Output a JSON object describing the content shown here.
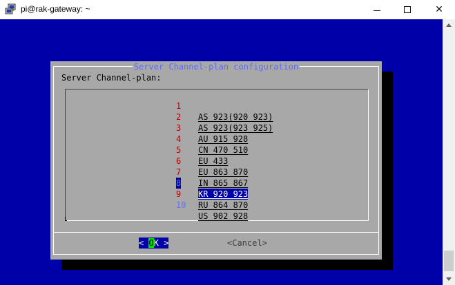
{
  "window": {
    "title": "pi@rak-gateway: ~",
    "icons": {
      "app": "putty-icon",
      "minimize": "minimize-icon",
      "maximize": "maximize-icon",
      "close": "close-icon"
    },
    "close_glyph": "✕"
  },
  "dialog": {
    "title": "Server Channel-plan configuration",
    "prompt": "Server Channel-plan:",
    "items": [
      {
        "num": "1",
        "label": "AS_923(920_923)"
      },
      {
        "num": "2",
        "label": "AS_923(923_925)"
      },
      {
        "num": "3",
        "label": "AU_915_928"
      },
      {
        "num": "4",
        "label": "CN_470_510"
      },
      {
        "num": "5",
        "label": "EU_433"
      },
      {
        "num": "6",
        "label": "EU_863_870"
      },
      {
        "num": "7",
        "label": "IN_865_867"
      },
      {
        "num": "8",
        "label": "KR_920_923"
      },
      {
        "num": "9",
        "label": "RU_864_870"
      },
      {
        "num": "10",
        "label": "US_902_928"
      }
    ],
    "selected_item": "8",
    "ok": {
      "left": "< ",
      "cursor": "O",
      "rest": "K",
      "right": " >"
    },
    "cancel_label": "<Cancel>"
  },
  "colors": {
    "terminal_bg": "#0000a8",
    "dialog_bg": "#a8a8a8",
    "title_fg": "#5c6cff",
    "item_number_fg": "#b00000",
    "highlight_bg": "#0000a8",
    "ok_cursor": "#00e000"
  }
}
